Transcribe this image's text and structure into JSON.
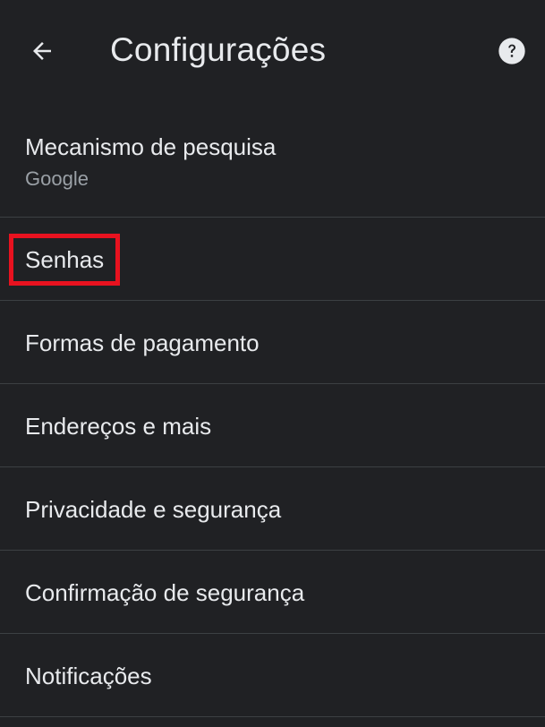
{
  "header": {
    "title": "Configurações",
    "back_icon": "arrow-left-icon",
    "help_icon": "help-circle-icon"
  },
  "settings": {
    "items": [
      {
        "label": "Mecanismo de pesquisa",
        "sublabel": "Google"
      },
      {
        "label": "Senhas",
        "highlighted": true
      },
      {
        "label": "Formas de pagamento"
      },
      {
        "label": "Endereços e mais"
      },
      {
        "label": "Privacidade e segurança"
      },
      {
        "label": "Confirmação de segurança"
      },
      {
        "label": "Notificações"
      }
    ]
  },
  "colors": {
    "background": "#202124",
    "text_primary": "#e8eaed",
    "text_secondary": "#9aa0a6",
    "divider": "#3c4043",
    "highlight": "#e8121f"
  }
}
